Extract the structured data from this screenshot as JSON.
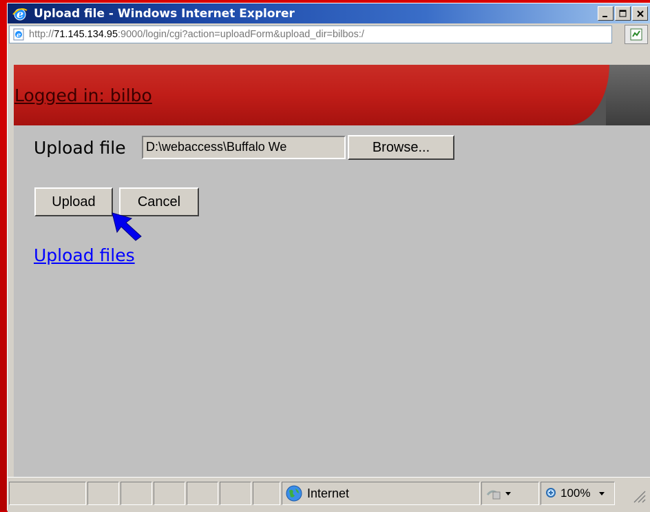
{
  "window": {
    "title": "Upload file - Windows Internet Explorer",
    "url_prefix": "http://",
    "url_host": "71.145.134.95",
    "url_rest": ":9000/login/cgi?action=uploadForm&upload_dir=bilbos:/"
  },
  "page": {
    "logged_in": "Logged in: bilbo",
    "upload_label": "Upload file",
    "file_value": "D:\\webaccess\\Buffalo We",
    "browse_label": "Browse...",
    "upload_button": "Upload",
    "cancel_button": "Cancel",
    "upload_files_link": "Upload files"
  },
  "status": {
    "zone": "Internet",
    "zoom": "100%"
  },
  "colors": {
    "background": "#cc0000",
    "banner": "#c01d18",
    "content": "#c0c0c0",
    "link": "#0000ff",
    "cursor_arrow": "#0000ff"
  },
  "icons": [
    "ie-logo-icon",
    "page-icon",
    "compatibility-view-icon",
    "minimize-icon",
    "maximize-icon",
    "close-icon",
    "globe-icon",
    "security-icon",
    "zoom-icon",
    "chevron-down-icon",
    "resize-grip-icon",
    "pointer-arrow-icon"
  ]
}
